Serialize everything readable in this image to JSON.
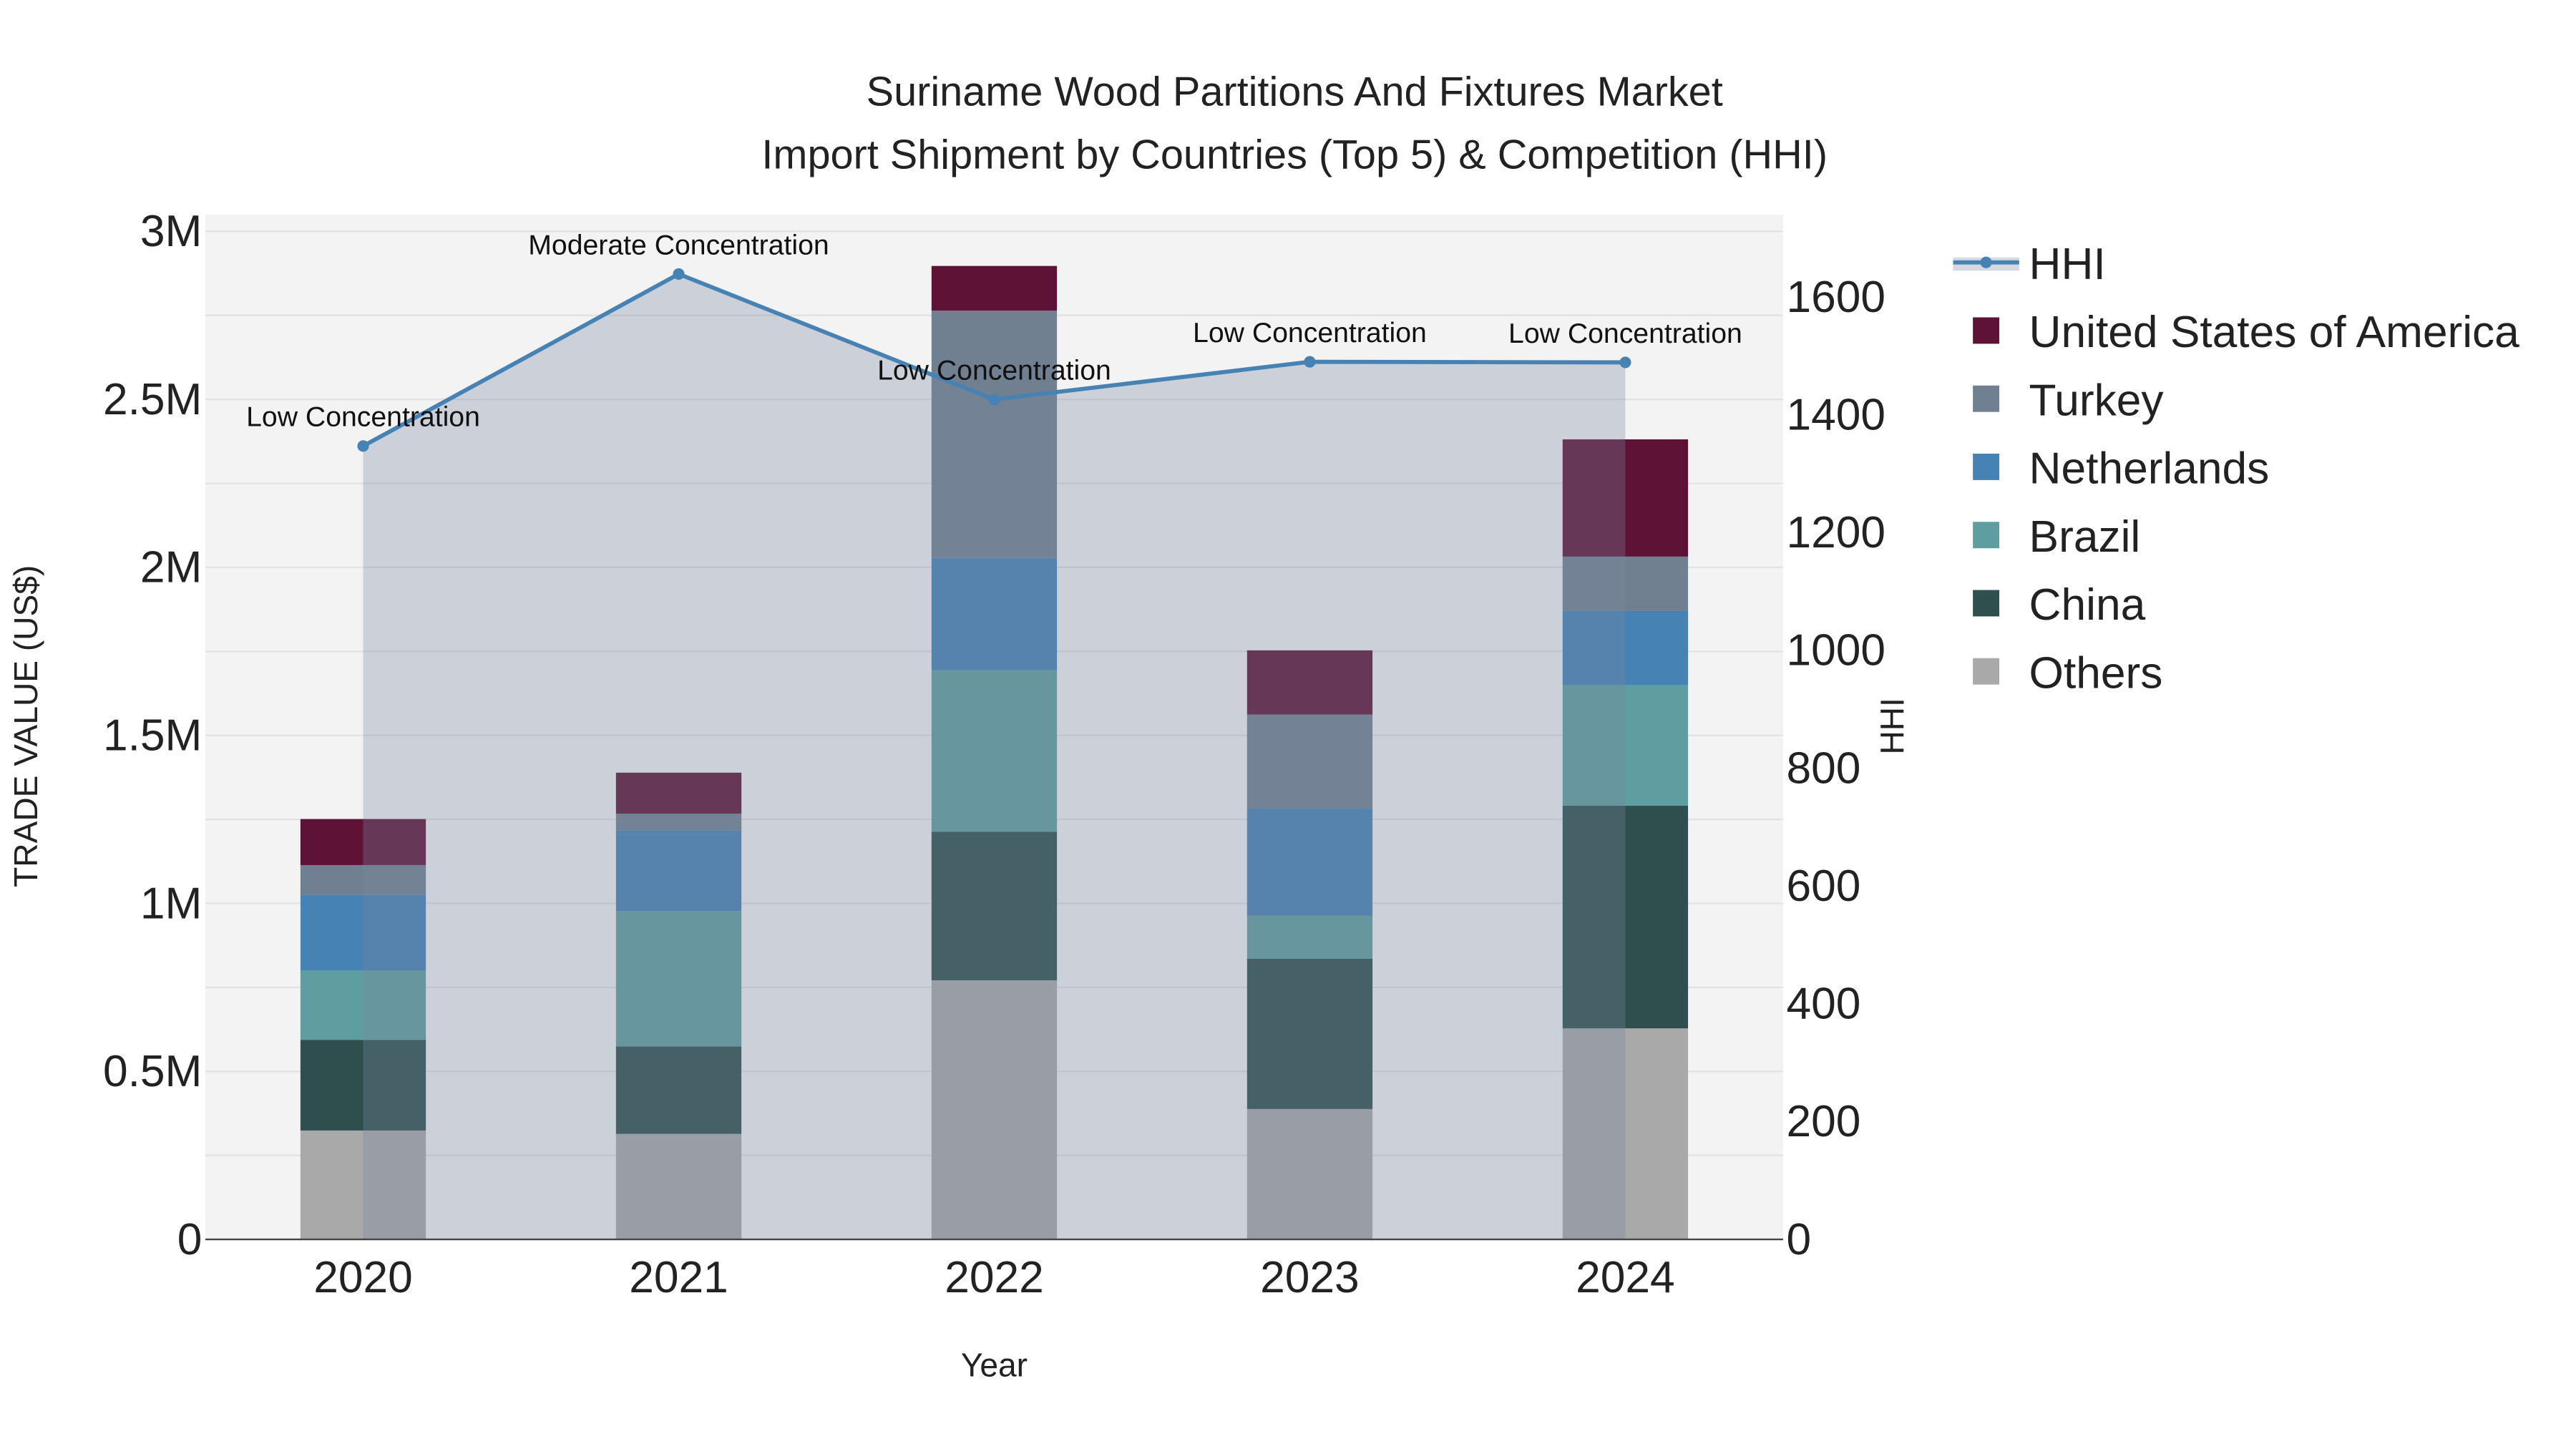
{
  "chart_data": {
    "type": "bar",
    "title": "Suriname Wood Partitions And Fixtures Market",
    "subtitle": "Import Shipment by Countries (Top 5) & Competition (HHI)",
    "xlabel": "Year",
    "ylabel": "TRADE VALUE (US$)",
    "y2label": "HHI",
    "categories": [
      "2020",
      "2021",
      "2022",
      "2023",
      "2024"
    ],
    "ylim": [
      0,
      3050000
    ],
    "y2lim": [
      0,
      1740
    ],
    "yticks": [
      0,
      500000,
      1000000,
      1500000,
      2000000,
      2500000,
      3000000
    ],
    "ytick_labels": [
      "0",
      "0.5M",
      "1M",
      "1.5M",
      "2M",
      "2.5M",
      "3M"
    ],
    "y2ticks": [
      0,
      200,
      400,
      600,
      800,
      1000,
      1200,
      1400,
      1600
    ],
    "y2tick_labels": [
      "0",
      "200",
      "400",
      "600",
      "800",
      "1000",
      "1200",
      "1400",
      "1600"
    ],
    "series": [
      {
        "name": "Others",
        "color": "#a9a9a9",
        "values": [
          324000,
          314000,
          771000,
          388000,
          628000
        ]
      },
      {
        "name": "China",
        "color": "#2f4f4f",
        "values": [
          270000,
          260000,
          442000,
          447000,
          663000
        ]
      },
      {
        "name": "Brazil",
        "color": "#5f9ea0",
        "values": [
          206000,
          403000,
          481000,
          128000,
          358000
        ]
      },
      {
        "name": "Netherlands",
        "color": "#4682b4",
        "values": [
          226000,
          240000,
          334000,
          319000,
          221000
        ]
      },
      {
        "name": "Turkey",
        "color": "#708090",
        "values": [
          88000,
          50000,
          736000,
          280000,
          162000
        ]
      },
      {
        "name": "United States of America",
        "color": "#5e1235",
        "values": [
          137000,
          122000,
          133000,
          191000,
          349000
        ]
      }
    ],
    "hhi": {
      "name": "HHI",
      "color": "#4682b4",
      "values": [
        1347,
        1639,
        1426,
        1490,
        1489
      ],
      "annotations": [
        "Low Concentration",
        "Moderate Concentration",
        "Low Concentration",
        "Low Concentration",
        "Low Concentration"
      ]
    },
    "legend_order": [
      "HHI",
      "United States of America",
      "Turkey",
      "Netherlands",
      "Brazil",
      "China",
      "Others"
    ],
    "legend_placement": "right",
    "grid": true
  }
}
